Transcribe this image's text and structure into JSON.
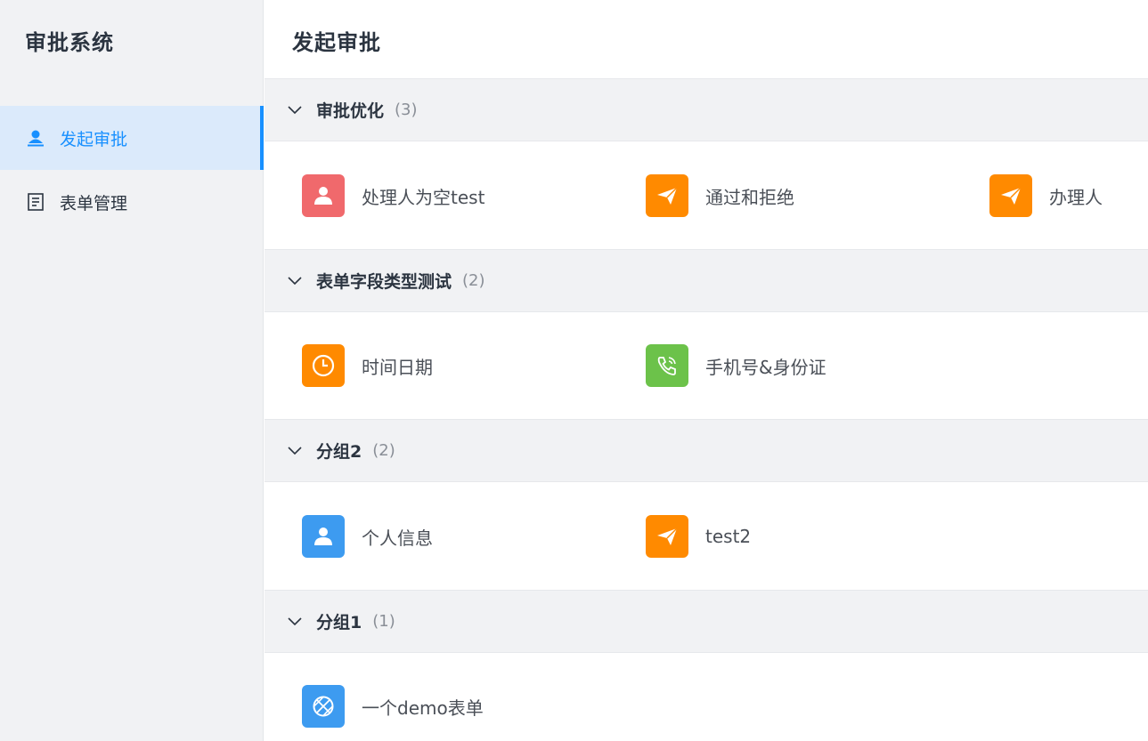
{
  "sidebar": {
    "brand": "审批系统",
    "items": [
      {
        "label": "发起审批",
        "icon": "user-icon",
        "active": true
      },
      {
        "label": "表单管理",
        "icon": "document-icon",
        "active": false
      }
    ]
  },
  "main": {
    "title": "发起审批",
    "groups": [
      {
        "name": "审批优化",
        "count": "(3)",
        "items": [
          {
            "label": "处理人为空test",
            "icon": "user-icon",
            "color": "#f0696c"
          },
          {
            "label": "通过和拒绝",
            "icon": "paper-plane-icon",
            "color": "#ff8a00"
          },
          {
            "label": "办理人",
            "icon": "paper-plane-icon",
            "color": "#ff8a00"
          }
        ]
      },
      {
        "name": "表单字段类型测试",
        "count": "(2)",
        "items": [
          {
            "label": "时间日期",
            "icon": "clock-icon",
            "color": "#ff8a00"
          },
          {
            "label": "手机号&身份证",
            "icon": "phone-icon",
            "color": "#6cc24a"
          }
        ]
      },
      {
        "name": "分组2",
        "count": "(2)",
        "items": [
          {
            "label": "个人信息",
            "icon": "user-icon",
            "color": "#3d9bf0"
          },
          {
            "label": "test2",
            "icon": "paper-plane-icon",
            "color": "#ff8a00"
          }
        ]
      },
      {
        "name": "分组1",
        "count": "(1)",
        "items": [
          {
            "label": "一个demo表单",
            "icon": "basketball-icon",
            "color": "#3d9bf0"
          }
        ]
      }
    ]
  }
}
